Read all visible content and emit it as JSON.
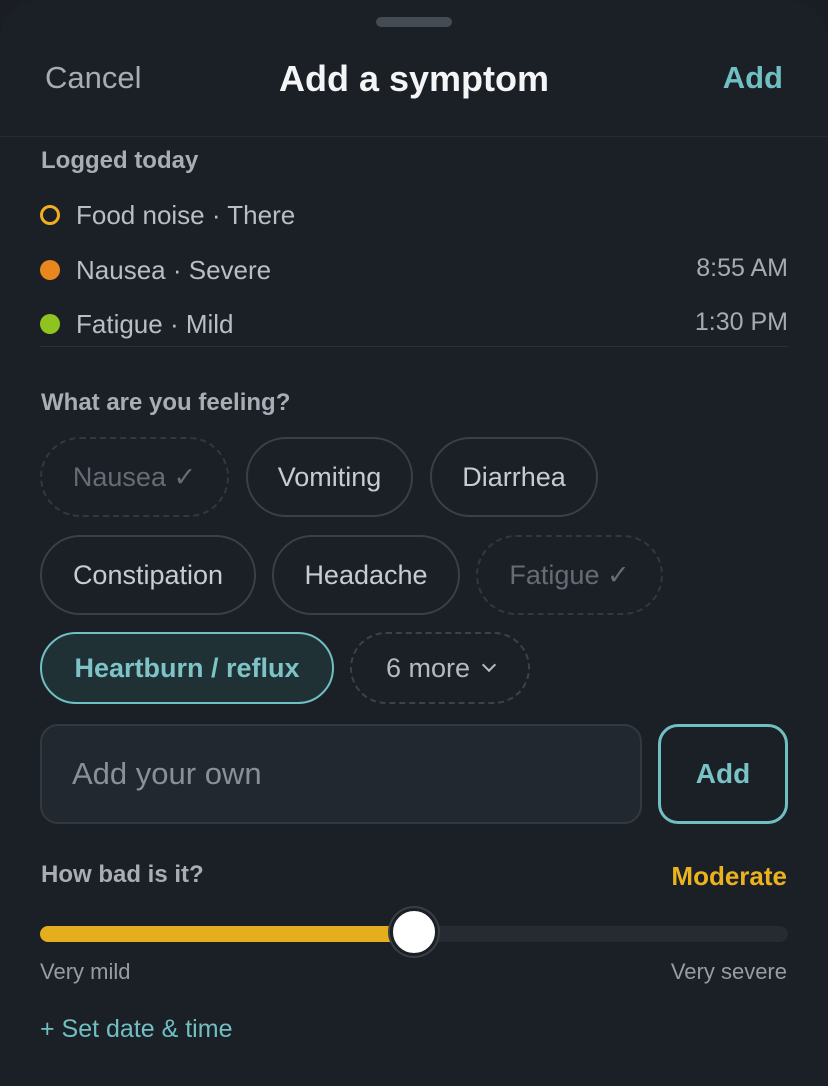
{
  "header": {
    "cancel_label": "Cancel",
    "title": "Add a symptom",
    "add_label": "Add"
  },
  "logged_today": {
    "heading": "Logged today",
    "items": [
      {
        "text": "Food noise · There",
        "time": "",
        "dot_style": "hollow",
        "color": "#f2ae1f"
      },
      {
        "text": "Nausea · Severe",
        "time": "8:55 AM",
        "dot_style": "filled",
        "color": "#e8871d"
      },
      {
        "text": "Fatigue · Mild",
        "time": "1:30 PM",
        "dot_style": "filled",
        "color": "#8fc31f"
      }
    ]
  },
  "feeling": {
    "heading": "What are you feeling?",
    "chips": [
      {
        "label": "Nausea ✓",
        "state": "disabled"
      },
      {
        "label": "Vomiting",
        "state": "default"
      },
      {
        "label": "Diarrhea",
        "state": "default"
      },
      {
        "label": "Constipation",
        "state": "default"
      },
      {
        "label": "Headache",
        "state": "default"
      },
      {
        "label": "Fatigue ✓",
        "state": "disabled"
      },
      {
        "label": "Heartburn / reflux",
        "state": "selected"
      }
    ],
    "more_label": "6 more",
    "custom_placeholder": "Add your own",
    "custom_add_label": "Add"
  },
  "severity": {
    "heading": "How bad is it?",
    "value_label": "Moderate",
    "level": 0.5,
    "min_label": "Very mild",
    "max_label": "Very severe"
  },
  "set_date_label": "+ Set date & time",
  "colors": {
    "accent_teal": "#6fbfc3",
    "severity_yellow": "#e5ae1c",
    "background": "#1b1f26"
  }
}
